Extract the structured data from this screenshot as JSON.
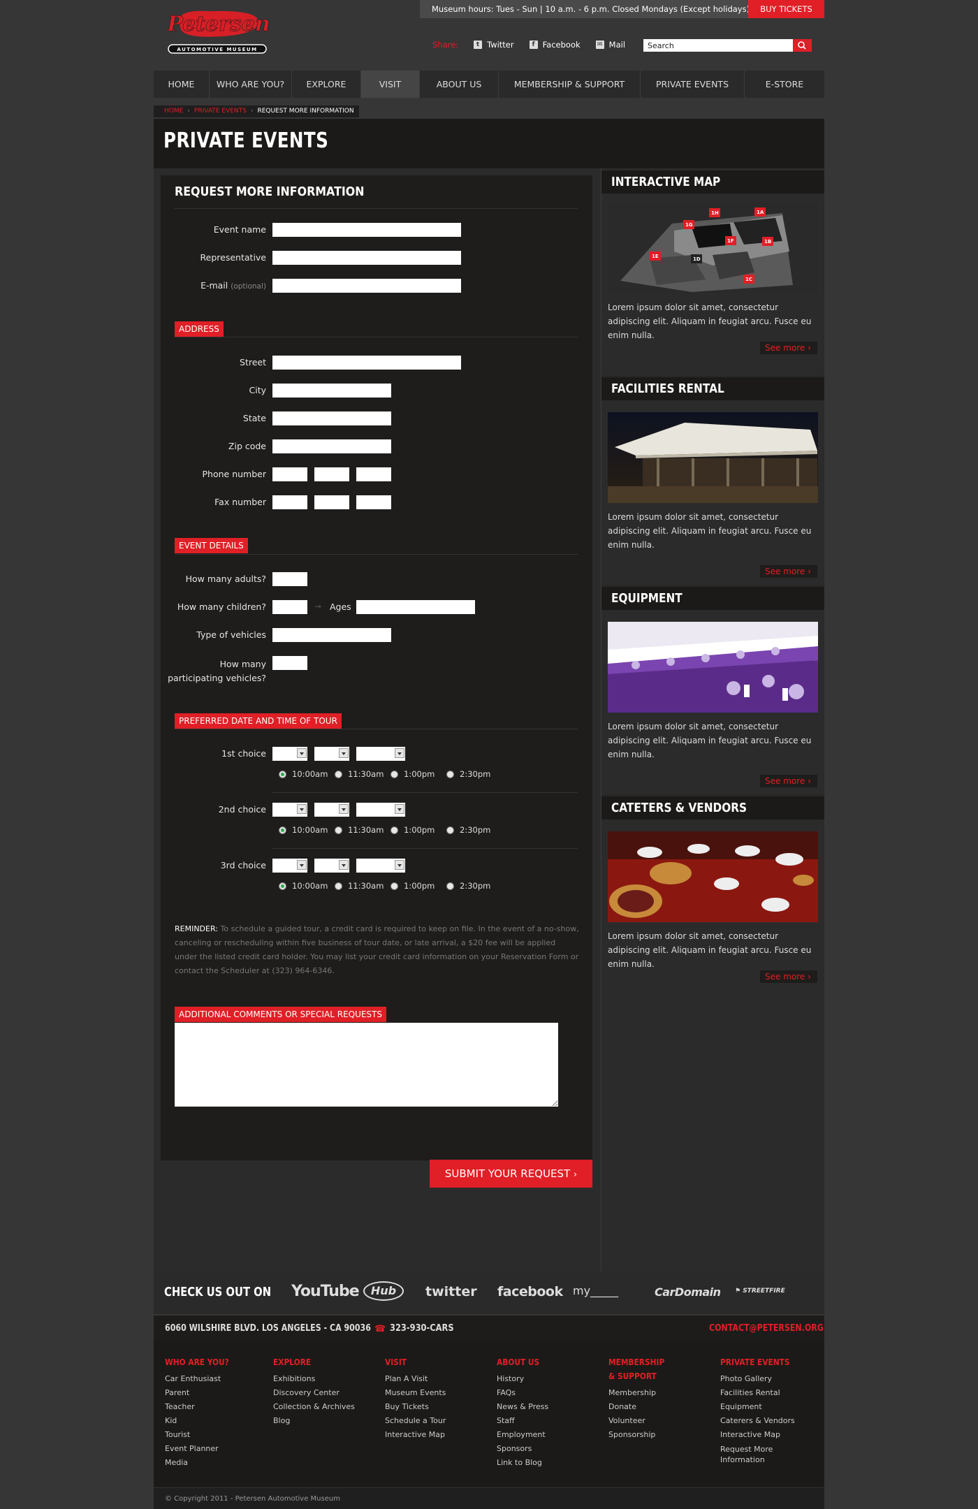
{
  "header": {
    "museum_hours": "Museum hours: Tues - Sun | 10 a.m. - 6 p.m. Closed Mondays (Except holidays)",
    "buy_tickets": "BUY TICKETS",
    "logo_text": "Petersen",
    "logo_subtext": "AUTOMOTIVE MUSEUM",
    "share_label": "Share:",
    "share_items": [
      "Twitter",
      "Facebook",
      "Mail"
    ],
    "search_placeholder": "Search"
  },
  "nav": {
    "items": [
      "HOME",
      "WHO ARE YOU?",
      "EXPLORE",
      "VISIT",
      "ABOUT US",
      "MEMBERSHIP & SUPPORT",
      "PRIVATE EVENTS",
      "E-STORE"
    ],
    "active": "VISIT"
  },
  "breadcrumb": [
    "HOME",
    "PRIVATE EVENTS",
    "REQUEST MORE INFORMATION"
  ],
  "page_title": "PRIVATE EVENTS",
  "form": {
    "title": "REQUEST MORE INFORMATION",
    "event_name": "Event name",
    "representative": "Representative",
    "email": "E-mail",
    "optional": "(optional)",
    "address_tag": "ADDRESS",
    "street": "Street",
    "city": "City",
    "state": "State",
    "zip": "Zip code",
    "phone": "Phone number",
    "fax": "Fax number",
    "event_tag": "EVENT DETAILS",
    "adults": "How many adults?",
    "children": "How many children?",
    "ages": "Ages",
    "vehicles": "Type of vehicles",
    "participating_1": "How many",
    "participating_2": "participating vehicles?",
    "date_tag": "PREFERRED DATE AND TIME OF TOUR",
    "choices": [
      "1st choice",
      "2nd choice",
      "3rd choice"
    ],
    "times": [
      "10:00am",
      "11:30am",
      "1:00pm",
      "2:30pm"
    ],
    "selected_time": "10:00am",
    "reminder_label": "REMINDER:",
    "reminder_text": "To schedule a guided tour, a credit card is required to keep on file. In the event of a no-show, canceling or rescheduling within five business of tour date, or late arrival, a $20 fee will be applied under the listed credit card holder. You may list your credit card information on your Reservation Form or contact the Scheduler at (323) 964-6346.",
    "comments_tag": "ADDITIONAL COMMENTS OR SPECIAL REQUESTS",
    "submit": "SUBMIT YOUR REQUEST"
  },
  "sidebar": {
    "lorem_a": "Lorem ipsum dolor sit amet, consectetur adipiscing elit. Aliquam in feugiat arcu. Fusce eu enim nulla.",
    "see_more": "See more",
    "sections": [
      {
        "title": "INTERACTIVE MAP",
        "map_labels": [
          "1H",
          "1A",
          "1G",
          "1F",
          "1B",
          "1E",
          "1D",
          "1C"
        ]
      },
      {
        "title": "FACILITIES RENTAL"
      },
      {
        "title": "EQUIPMENT"
      },
      {
        "title": "CATETERS & VENDORS"
      }
    ]
  },
  "footer": {
    "check_us_out": "CHECK US OUT ON",
    "social": [
      "YouTube",
      "Hub",
      "twitter",
      "facebook",
      "my_____",
      "CarDomain",
      "STREETFIRE"
    ],
    "address": "6060 WILSHIRE BLVD. LOS ANGELES - CA 90036",
    "phone": "323-930-CARS",
    "contact": "CONTACT@PETERSEN.ORG",
    "columns": [
      {
        "head": "WHO ARE YOU?",
        "links": [
          "Car Enthusiast",
          "Parent",
          "Teacher",
          "Kid",
          "Tourist",
          "Event Planner",
          "Media"
        ]
      },
      {
        "head": "EXPLORE",
        "links": [
          "Exhibitions",
          "Discovery Center",
          "Collection & Archives",
          "Blog"
        ]
      },
      {
        "head": "VISIT",
        "links": [
          "Plan A Visit",
          "Museum Events",
          "Buy Tickets",
          "Schedule a Tour",
          "Interactive Map"
        ]
      },
      {
        "head": "ABOUT US",
        "links": [
          "History",
          "FAQs",
          "News & Press",
          "Staff",
          "Employment",
          "Sponsors",
          "Link to Blog"
        ]
      },
      {
        "head": "MEMBERSHIP",
        "head2": "& SUPPORT",
        "links": [
          "Membership",
          "Donate",
          "Volunteer",
          "Sponsorship"
        ]
      },
      {
        "head": "PRIVATE EVENTS",
        "links": [
          "Photo Gallery",
          "Facilities Rental",
          "Equipment",
          "Caterers & Vendors",
          "Interactive Map",
          "Request More",
          "Information"
        ]
      }
    ],
    "copyright": "© Copyright 2011 - Petersen Automotive Museum"
  },
  "colors": {
    "accent": "#e01f26",
    "background": "#363636",
    "panel": "#1e1d1b"
  }
}
